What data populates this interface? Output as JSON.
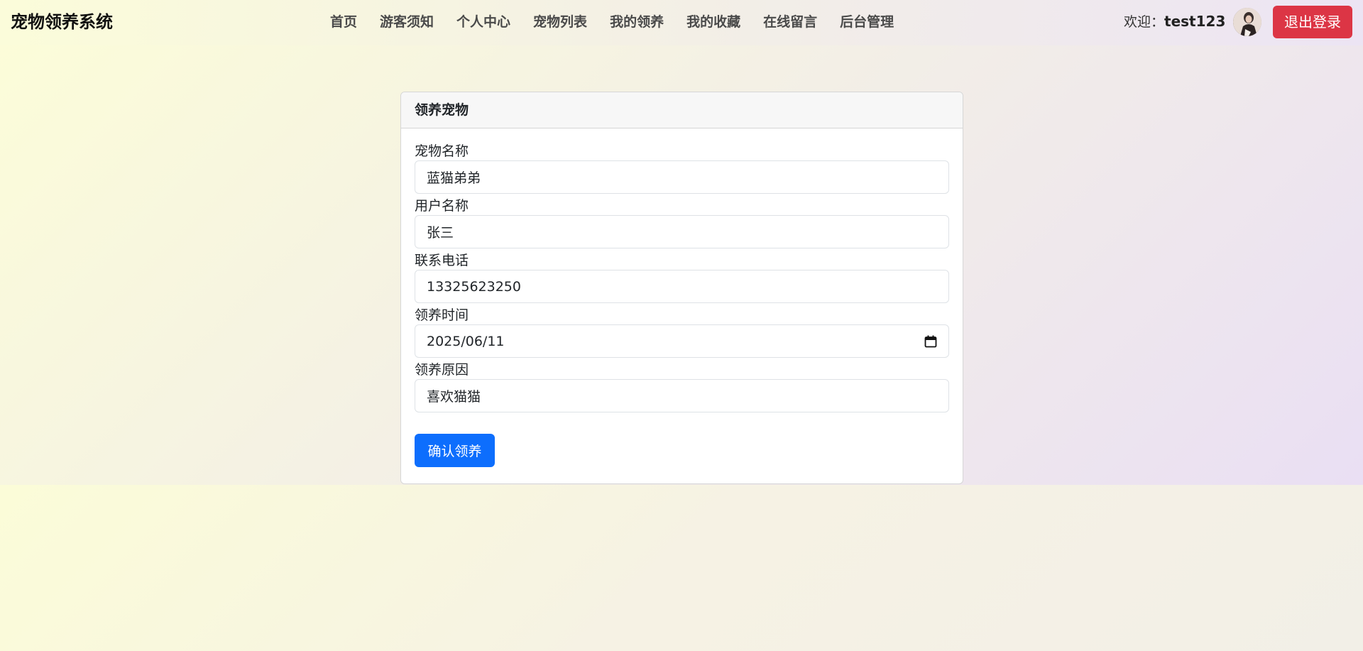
{
  "brand": {
    "title": "宠物领养系统"
  },
  "nav": {
    "items": [
      {
        "label": "首页"
      },
      {
        "label": "游客须知"
      },
      {
        "label": "个人中心"
      },
      {
        "label": "宠物列表"
      },
      {
        "label": "我的领养"
      },
      {
        "label": "我的收藏"
      },
      {
        "label": "在线留言"
      },
      {
        "label": "后台管理"
      }
    ]
  },
  "user": {
    "welcome_prefix": "欢迎：",
    "username": "test123",
    "avatar_icon": "avatar-photo",
    "logout_label": "退出登录"
  },
  "form": {
    "title": "领养宠物",
    "fields": [
      {
        "label": "宠物名称",
        "value": "蓝猫弟弟"
      },
      {
        "label": "用户名称",
        "value": "张三"
      },
      {
        "label": "联系电话",
        "value": "13325623250"
      },
      {
        "label": "领养时间",
        "value": "2025/06/11",
        "icon": "calendar-icon"
      },
      {
        "label": "领养原因",
        "value": "喜欢猫猫"
      }
    ],
    "submit_label": "确认领养"
  },
  "colors": {
    "danger": "#dc3545",
    "primary": "#0d6efd"
  }
}
